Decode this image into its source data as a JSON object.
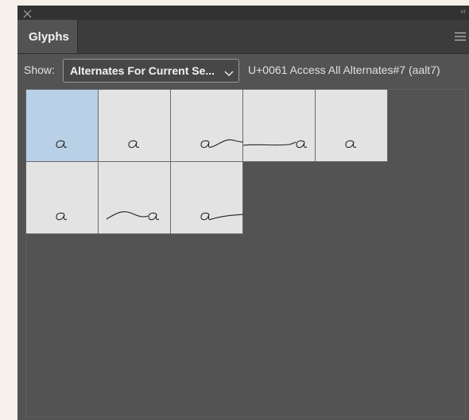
{
  "panel": {
    "title_tab": "Glyphs",
    "close_icon": "close-icon",
    "collapse_icon": "collapse-icon",
    "menu_icon": "panel-menu-icon"
  },
  "toolbar": {
    "show_label": "Show:",
    "show_value": "Alternates For Current Se...",
    "glyph_info": "U+0061 Access All Alternates#7 (aalt7)"
  },
  "glyphs": [
    {
      "name": "glyph-a-alt-1",
      "variant": "plain",
      "selected": true
    },
    {
      "name": "glyph-a-alt-2",
      "variant": "plain",
      "selected": false
    },
    {
      "name": "glyph-a-alt-3",
      "variant": "swash-right-curve",
      "selected": false
    },
    {
      "name": "glyph-a-alt-4",
      "variant": "swash-left-long",
      "selected": false
    },
    {
      "name": "glyph-a-alt-5",
      "variant": "plain",
      "selected": false
    },
    {
      "name": "glyph-a-alt-6",
      "variant": "plain",
      "selected": false
    },
    {
      "name": "glyph-a-alt-7",
      "variant": "swash-left-wave",
      "selected": false
    },
    {
      "name": "glyph-a-alt-8",
      "variant": "swash-right-long",
      "selected": false
    }
  ],
  "colors": {
    "panel_bg": "#535353",
    "cell_bg": "#e3e3e3",
    "selected_cell_bg": "#b8d1e6"
  }
}
